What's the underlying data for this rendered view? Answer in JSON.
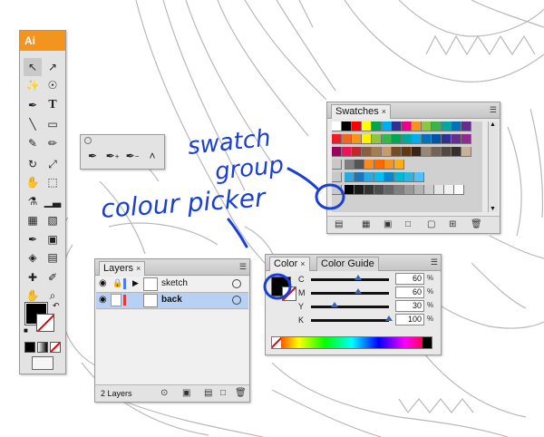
{
  "toolbar": {
    "logo": "Ai"
  },
  "pen_flyout": {
    "tools": [
      "pen-icon",
      "add-anchor-icon",
      "delete-anchor-icon",
      "convert-anchor-icon"
    ]
  },
  "swatches": {
    "tab_label": "Swatches",
    "close_glyph": "×",
    "rows": [
      [
        "#ffffff",
        "#000000",
        "#ff0000",
        "#ffff00",
        "#00a650",
        "#00aeef",
        "#2e3192",
        "#ec008c",
        "#f7941d",
        "#8dc63f",
        "#39b54a",
        "#00a99d",
        "#0072bc",
        "#662d91"
      ],
      [
        "#ed1c24",
        "#f26522",
        "#f7941d",
        "#fff200",
        "#8dc63f",
        "#39b54a",
        "#00a651",
        "#00a99d",
        "#00aeef",
        "#0072bc",
        "#0054a6",
        "#2e3192",
        "#662d91",
        "#92278f"
      ],
      [
        "#9e005d",
        "#ed145b",
        "#c1272d",
        "#8b5e3c",
        "#a67c52",
        "#c69c6d",
        "#754c24",
        "#603913",
        "#3c2415",
        "#998675",
        "#736357",
        "#534741",
        "#362f2d",
        "#c7b299"
      ],
      [
        "#7f7f7f",
        "#555555",
        "#ff8c1a",
        "#ff6a00",
        "#f7941d",
        "#fbad18"
      ],
      [
        "#29abe2",
        "#1b75bc",
        "#27aae1",
        "#00bff3",
        "#0089d0",
        "#00b8d4",
        "#2bb5e2",
        "#4fc3f7"
      ],
      [
        "#000000",
        "#1a1a1a",
        "#333333",
        "#4d4d4d",
        "#666666",
        "#808080",
        "#999999",
        "#b3b3b3",
        "#cccccc",
        "#e6e6e6",
        "#f2f2f2",
        "#ffffff"
      ]
    ]
  },
  "layers": {
    "tab_label": "Layers",
    "close_glyph": "×",
    "items": [
      {
        "name": "sketch"
      },
      {
        "name": "back"
      }
    ],
    "count_label": "2 Layers"
  },
  "color": {
    "tab_label": "Color",
    "guide_tab_label": "Color Guide",
    "channels": [
      {
        "label": "C",
        "value": "60",
        "fraction": 0.6
      },
      {
        "label": "M",
        "value": "60",
        "fraction": 0.6
      },
      {
        "label": "Y",
        "value": "30",
        "fraction": 0.3
      },
      {
        "label": "K",
        "value": "100",
        "fraction": 1.0
      }
    ],
    "unit": "%"
  },
  "annotations": {
    "swatch_group": "swatch\ngroup",
    "colour_picker": "colour picker"
  },
  "colors": {
    "annotation_blue": "#1a3fd6",
    "thumb_blue": "#3c64b4",
    "layer_highlight": "#b6d1f4",
    "logo_orange": "#f3941e"
  }
}
